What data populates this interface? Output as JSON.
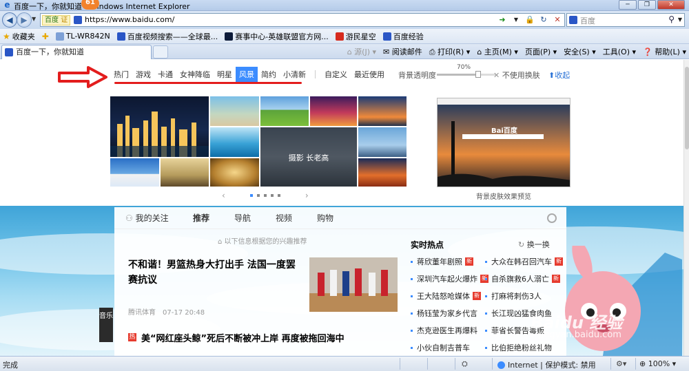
{
  "browser": {
    "window_title": "百度一下，你就知道 - Windows Internet Explorer",
    "notification_count": "61",
    "address_tag": "百度",
    "address_tag_ok": "证",
    "url": "https://www.baidu.com/",
    "search_placeholder": "百度",
    "favorites": [
      {
        "label": "收藏夹",
        "icon": "star-icon"
      },
      {
        "label": "TL-WR842N",
        "icon": "page-icon"
      },
      {
        "label": "百度视频搜索——全球最...",
        "icon": "baidu-icon"
      },
      {
        "label": "赛事中心-英雄联盟官方网...",
        "icon": "lol-icon"
      },
      {
        "label": "游民星空",
        "icon": "gamersky-icon"
      },
      {
        "label": "百度经验",
        "icon": "baidu-icon"
      }
    ],
    "tab_title": "百度一下，你就知道",
    "commands": {
      "feeds": "源(J)",
      "read_mail": "阅读邮件",
      "print": "打印(R)",
      "home": "主页(M)",
      "page": "页面(P)",
      "safety": "安全(S)",
      "tools": "工具(O)",
      "help": "帮助(L)"
    },
    "status": {
      "done": "完成",
      "zone": "Internet | 保护模式: 禁用",
      "zoom": "100%"
    }
  },
  "skin_panel": {
    "categories": [
      "热门",
      "游戏",
      "卡通",
      "女神降临",
      "明星",
      "风景",
      "简约",
      "小清新"
    ],
    "active_category": "风景",
    "extra": [
      "自定义",
      "最近使用"
    ],
    "opacity_label": "背景透明度",
    "opacity_value": "70%",
    "opacity_fraction": 0.7,
    "no_skin": "不使用换肤",
    "collapse": "收起",
    "center_tile_label": "摄影 长老高",
    "preview_label": "背景皮肤效果预览",
    "preview_logo": "Bai百度",
    "pager_prev": "‹",
    "pager_next": "›"
  },
  "feed": {
    "tabs": [
      "我的关注",
      "推荐",
      "导航",
      "视频",
      "购物"
    ],
    "active_tab": "推荐",
    "interest_note": "以下信息根据您的兴趣推荐",
    "article_title": "不和谐！男篮热身大打出手 法国一度罢赛抗议",
    "article_source": "腾讯体育",
    "article_time": "07-17 20:48",
    "article2_hot": "热",
    "article2_title": "美“网红座头鲸”死后不断被冲上岸 再度被拖回海中",
    "music_tag": "音乐"
  },
  "hot": {
    "title": "实时热点",
    "refresh": "换一换",
    "new_badge": "新",
    "left": [
      {
        "text": "蒋欣董年剧照",
        "new": true
      },
      {
        "text": "深圳汽车起火爆炸",
        "new": true
      },
      {
        "text": "王大陆怒呛媒体",
        "new": true
      },
      {
        "text": "杨钰莹为家乡代言",
        "new": false
      },
      {
        "text": "杰克逊医生再爆料",
        "new": false
      },
      {
        "text": "小伙自制吉普车",
        "new": false
      }
    ],
    "right": [
      {
        "text": "大众在韩召回汽车",
        "new": true
      },
      {
        "text": "自杀旗救6人溺亡",
        "new": true
      },
      {
        "text": "打麻将刺伤3人",
        "new": false
      },
      {
        "text": "长江现凶猛食肉鱼",
        "new": false
      },
      {
        "text": "菲省长警告毒贩",
        "new": false
      },
      {
        "text": "比伯拒绝粉丝礼物",
        "new": false
      }
    ]
  },
  "watermark": {
    "brand": "Baidu 经验",
    "url": "jingyan.baidu.com"
  },
  "colors": {
    "accent": "#3b8cff",
    "annotation_red": "#e31d1d",
    "hot_red": "#e63b2e"
  }
}
